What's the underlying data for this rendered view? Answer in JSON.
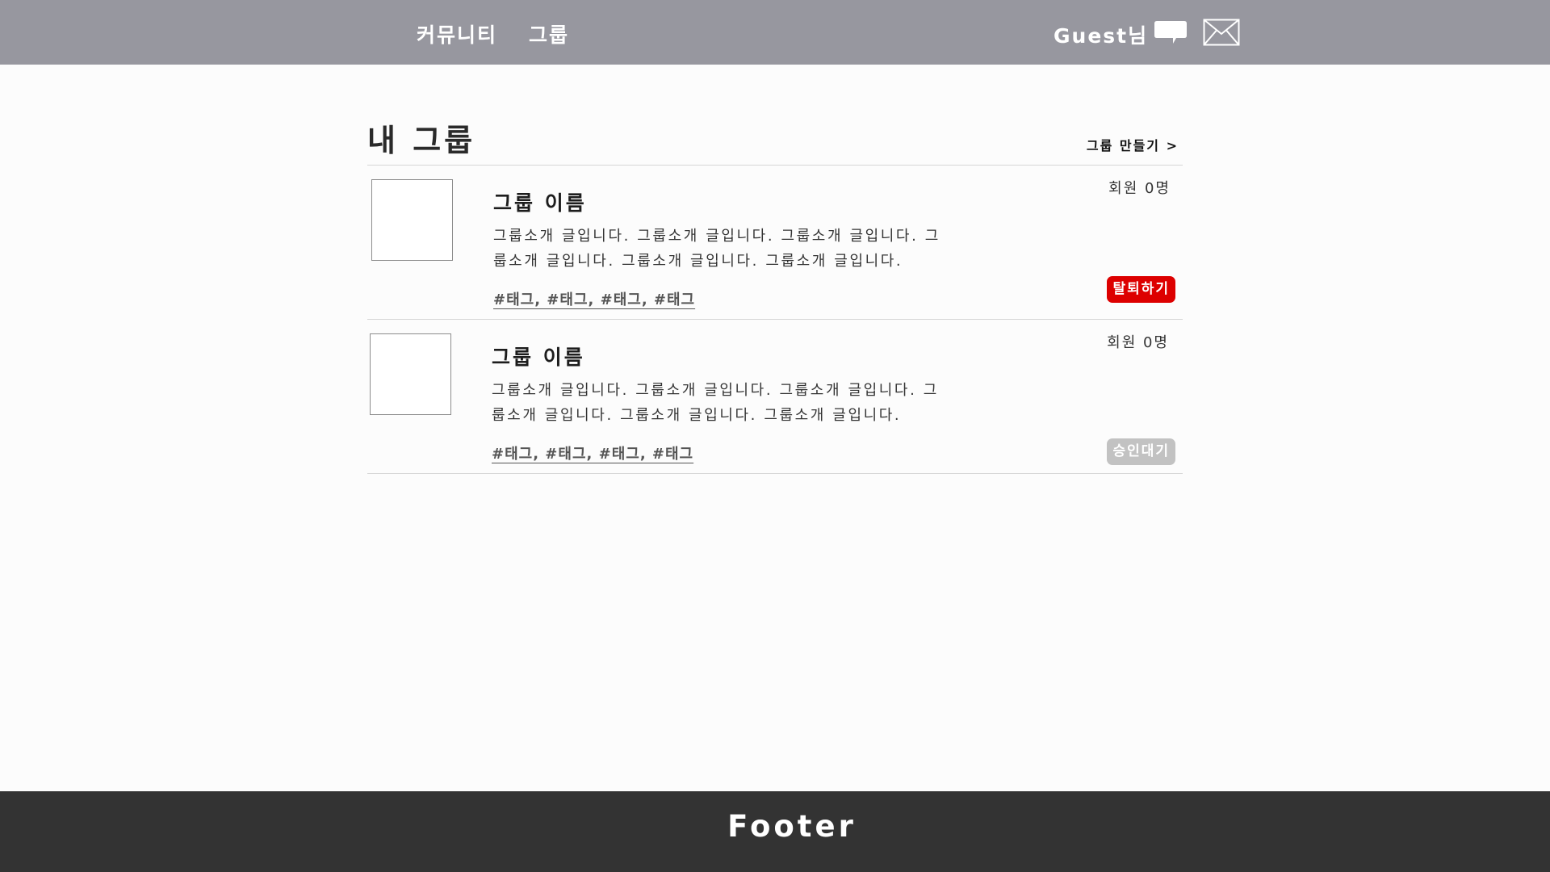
{
  "header": {
    "nav": {
      "community": "커뮤니티",
      "group": "그룹"
    },
    "user_greeting": "Guest님",
    "icons": {
      "chat": "chat-bubble-icon",
      "mail": "envelope-icon"
    },
    "background_color": "#97979f"
  },
  "main": {
    "title": "내 그룹",
    "create_group_link": "그룹 만들기 >",
    "groups": [
      {
        "name": "그룹 이름",
        "description": "그룹소개 글입니다. 그룹소개 글입니다. 그룹소개 글입니다. 그룹소개 글입니다. 그룹소개 글입니다. 그룹소개 글입니다.",
        "tags": "#태그, #태그, #태그, #태그",
        "member_count": "회원 0명",
        "action_label": "탈퇴하기",
        "action_color": "#dd0000"
      },
      {
        "name": "그룹 이름",
        "description": "그룹소개 글입니다. 그룹소개 글입니다. 그룹소개 글입니다. 그룹소개 글입니다. 그룹소개 글입니다. 그룹소개 글입니다.",
        "tags": "#태그, #태그, #태그, #태그",
        "member_count": "회원 0명",
        "action_label": "승인대기",
        "action_color": "#c2c2c2"
      }
    ]
  },
  "footer": {
    "label": "Footer",
    "background_color": "#333333"
  }
}
